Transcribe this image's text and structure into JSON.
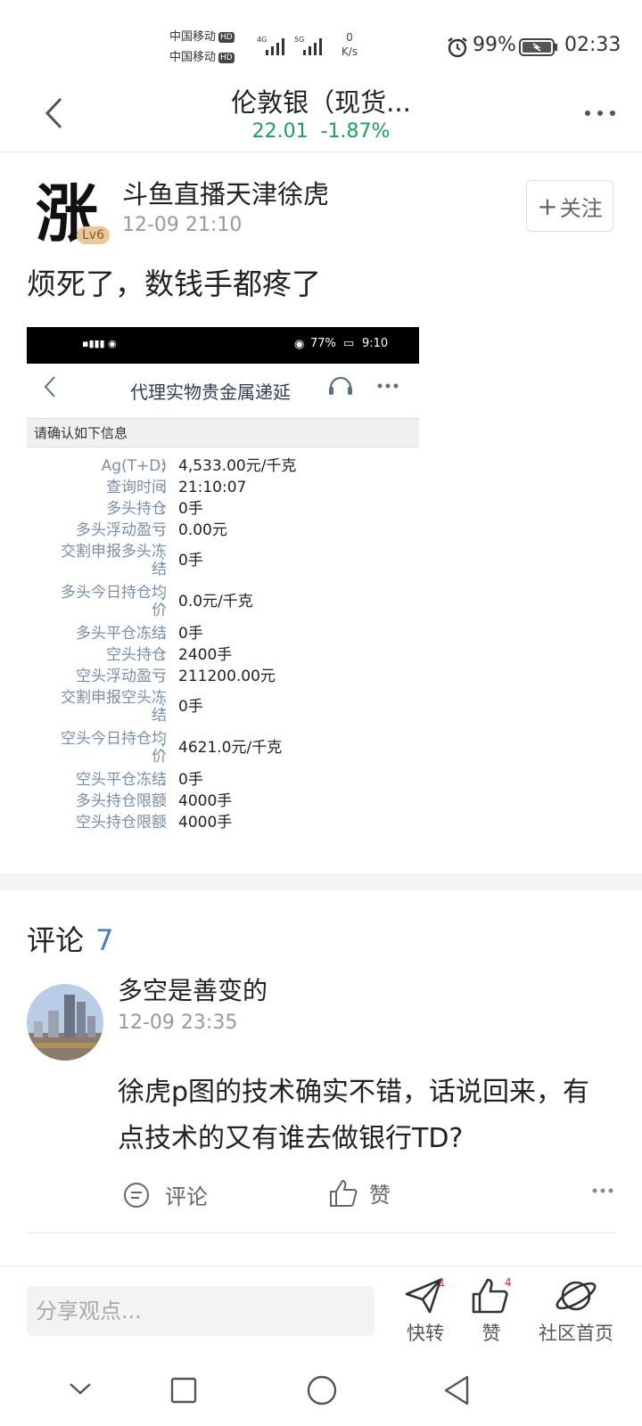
{
  "status_bar": {
    "carrier1": "中国移动",
    "carrier2": "中国移动",
    "hd": "HD",
    "net1": "4G",
    "net2": "5G",
    "speed_value": "0",
    "speed_unit": "K/s",
    "battery": "99%",
    "time": "02:33"
  },
  "header": {
    "title": "伦敦银（现货...",
    "price": "22.01",
    "change": "-1.87%"
  },
  "post": {
    "author": "斗鱼直播天津徐虎",
    "avatar_char": "涨",
    "level": "Lv6",
    "time": "12-09 21:10",
    "follow_label": "关注",
    "text": "烦死了，数钱手都疼了"
  },
  "screenshot": {
    "status": {
      "battery": "77%",
      "time": "9:10"
    },
    "title": "代理实物贵金属递延",
    "info_header": "请确认如下信息",
    "rows": [
      {
        "label": "Ag(T+D)",
        "value": "4,533.00元/千克"
      },
      {
        "label": "查询时间",
        "value": "21:10:07"
      },
      {
        "label": "多头持仓",
        "value": "0手"
      },
      {
        "label": "多头浮动盈亏",
        "value": "0.00元"
      },
      {
        "label": "交割申报多头冻\n结",
        "value": "0手"
      },
      {
        "label": "多头今日持仓均\n价",
        "value": "0.0元/千克"
      },
      {
        "label": "多头平仓冻结",
        "value": "0手"
      },
      {
        "label": "空头持仓",
        "value": "2400手"
      },
      {
        "label": "空头浮动盈亏",
        "value": "211200.00元"
      },
      {
        "label": "交割申报空头冻\n结",
        "value": "0手"
      },
      {
        "label": "空头今日持仓均\n价",
        "value": "4621.0元/千克"
      },
      {
        "label": "空头平仓冻结",
        "value": "0手"
      },
      {
        "label": "多头持仓限额",
        "value": "4000手"
      },
      {
        "label": "空头持仓限额",
        "value": "4000手"
      }
    ]
  },
  "comments": {
    "title": "评论",
    "count": "7",
    "items": [
      {
        "author": "多空是善变的",
        "time": "12-09 23:35",
        "text": "徐虎p图的技术确实不错，话说回来，有点技术的又有谁去做银行TD?",
        "comment_label": "评论",
        "like_label": "赞"
      }
    ]
  },
  "bottom_bar": {
    "placeholder": "分享观点...",
    "repost_label": "快转",
    "repost_count": "1",
    "like_label": "赞",
    "like_count": "4",
    "home_label": "社区首页"
  },
  "colors": {
    "price_green": "#1aa05a",
    "accent_blue": "#4a7fc8"
  }
}
